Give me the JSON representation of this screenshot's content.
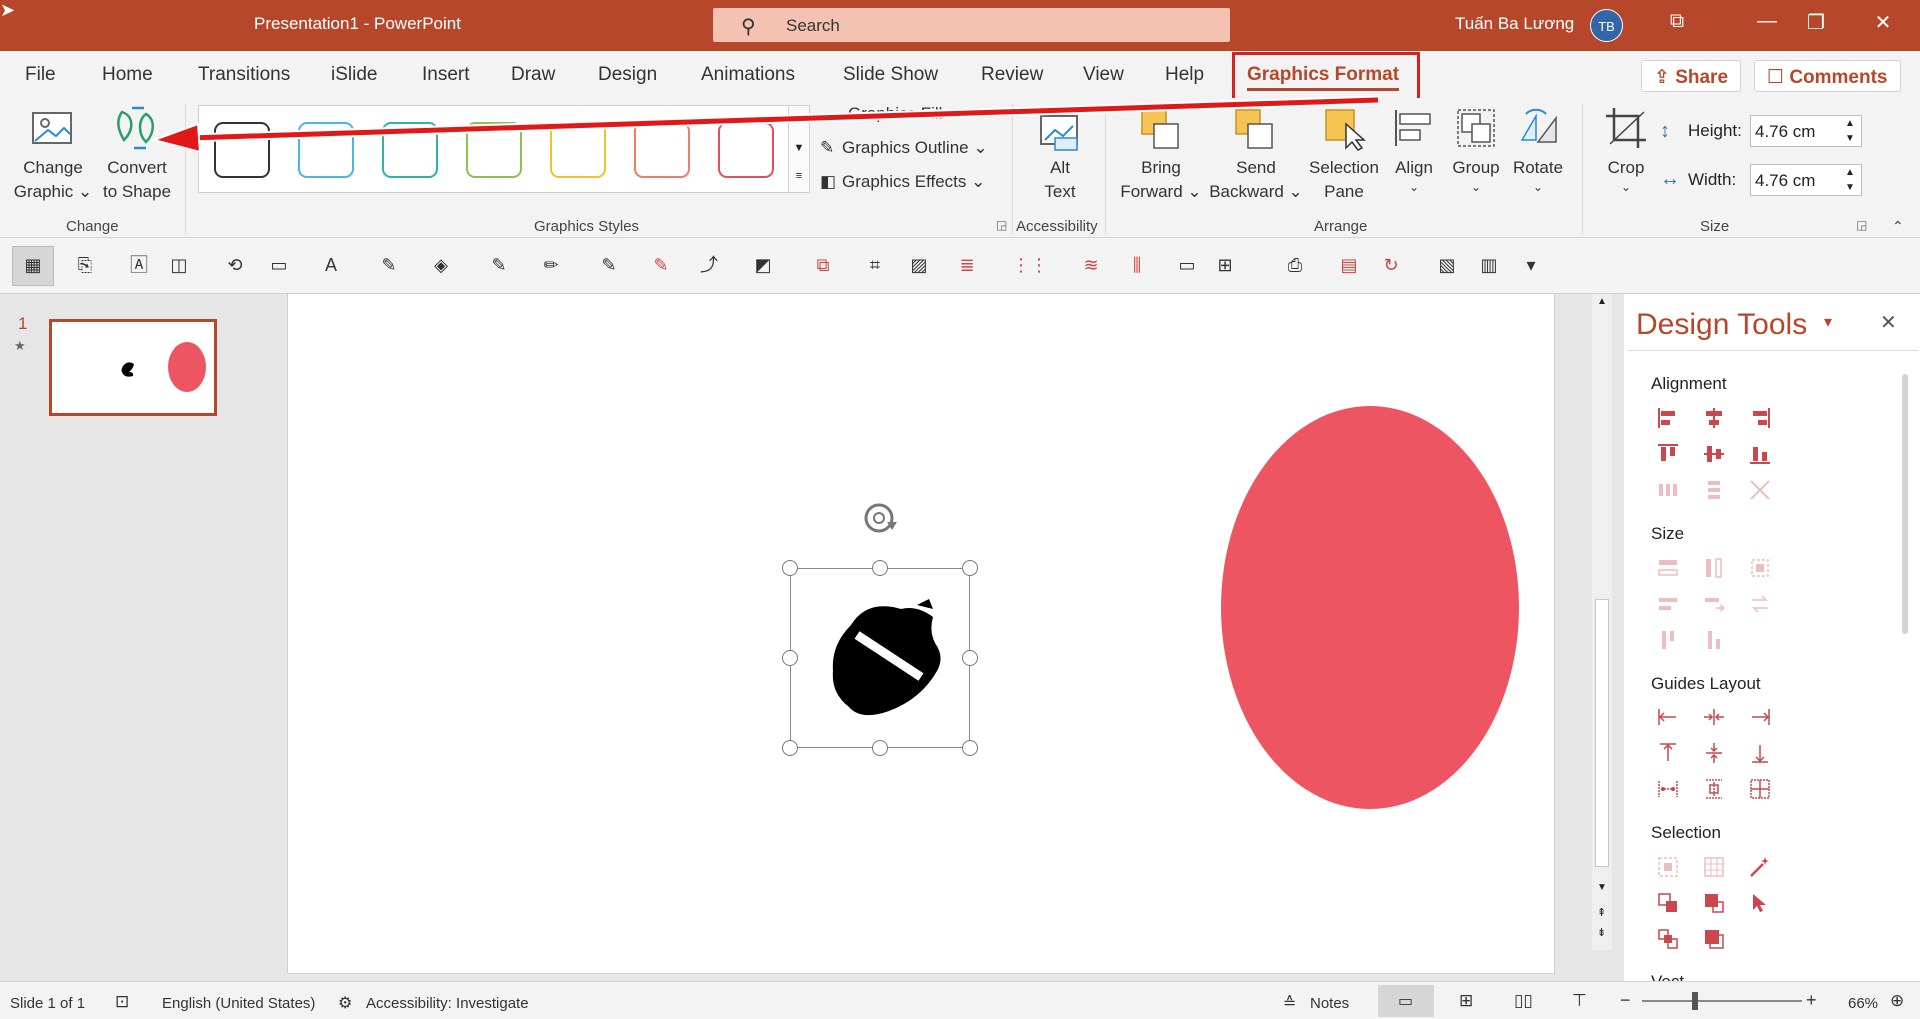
{
  "titlebar": {
    "title": "Presentation1  -  PowerPoint",
    "search_placeholder": "Search",
    "user": "Tuấn Ba Lương",
    "avatar": "TB"
  },
  "tabs": [
    "File",
    "Home",
    "Transitions",
    "iSlide",
    "Insert",
    "Draw",
    "Design",
    "Animations",
    "Slide Show",
    "Review",
    "View",
    "Help"
  ],
  "active_tab": "Graphics Format",
  "share_label": "Share",
  "comments_label": "Comments",
  "ribbon": {
    "change_graphic": [
      "Change",
      "Graphic ⌄"
    ],
    "convert_to_shape": [
      "Convert",
      "to Shape"
    ],
    "group_change": "Change",
    "group_styles": "Graphics Styles",
    "graphics_fill": "Graphics Fill",
    "graphics_outline": "Graphics Outline ⌄",
    "graphics_effects": "Graphics Effects ⌄",
    "alt_text": [
      "Alt",
      "Text"
    ],
    "group_accessibility": "Accessibility",
    "bring_forward": [
      "Bring",
      "Forward ⌄"
    ],
    "send_backward": [
      "Send",
      "Backward ⌄"
    ],
    "selection_pane": [
      "Selection",
      "Pane"
    ],
    "align": "Align",
    "group": "Group",
    "rotate": "Rotate",
    "group_arrange": "Arrange",
    "crop": "Crop",
    "height_label": "Height:",
    "height_value": "4.76 cm",
    "width_label": "Width:",
    "width_value": "4.76 cm",
    "group_size": "Size"
  },
  "style_colors": [
    "#333333",
    "#4bb3e6",
    "#2bb5a4",
    "#8dc04f",
    "#f2c12e",
    "#ef7b6b",
    "#e2505c"
  ],
  "slide_number": "1",
  "circle_color": "#ee5563",
  "design_tools": {
    "title": "Design Tools",
    "sections": [
      "Alignment",
      "Size",
      "Guides Layout",
      "Selection"
    ]
  },
  "status": {
    "slide": "Slide 1 of 1",
    "language": "English (United States)",
    "accessibility": "Accessibility: Investigate",
    "notes": "Notes",
    "zoom": "66%"
  }
}
